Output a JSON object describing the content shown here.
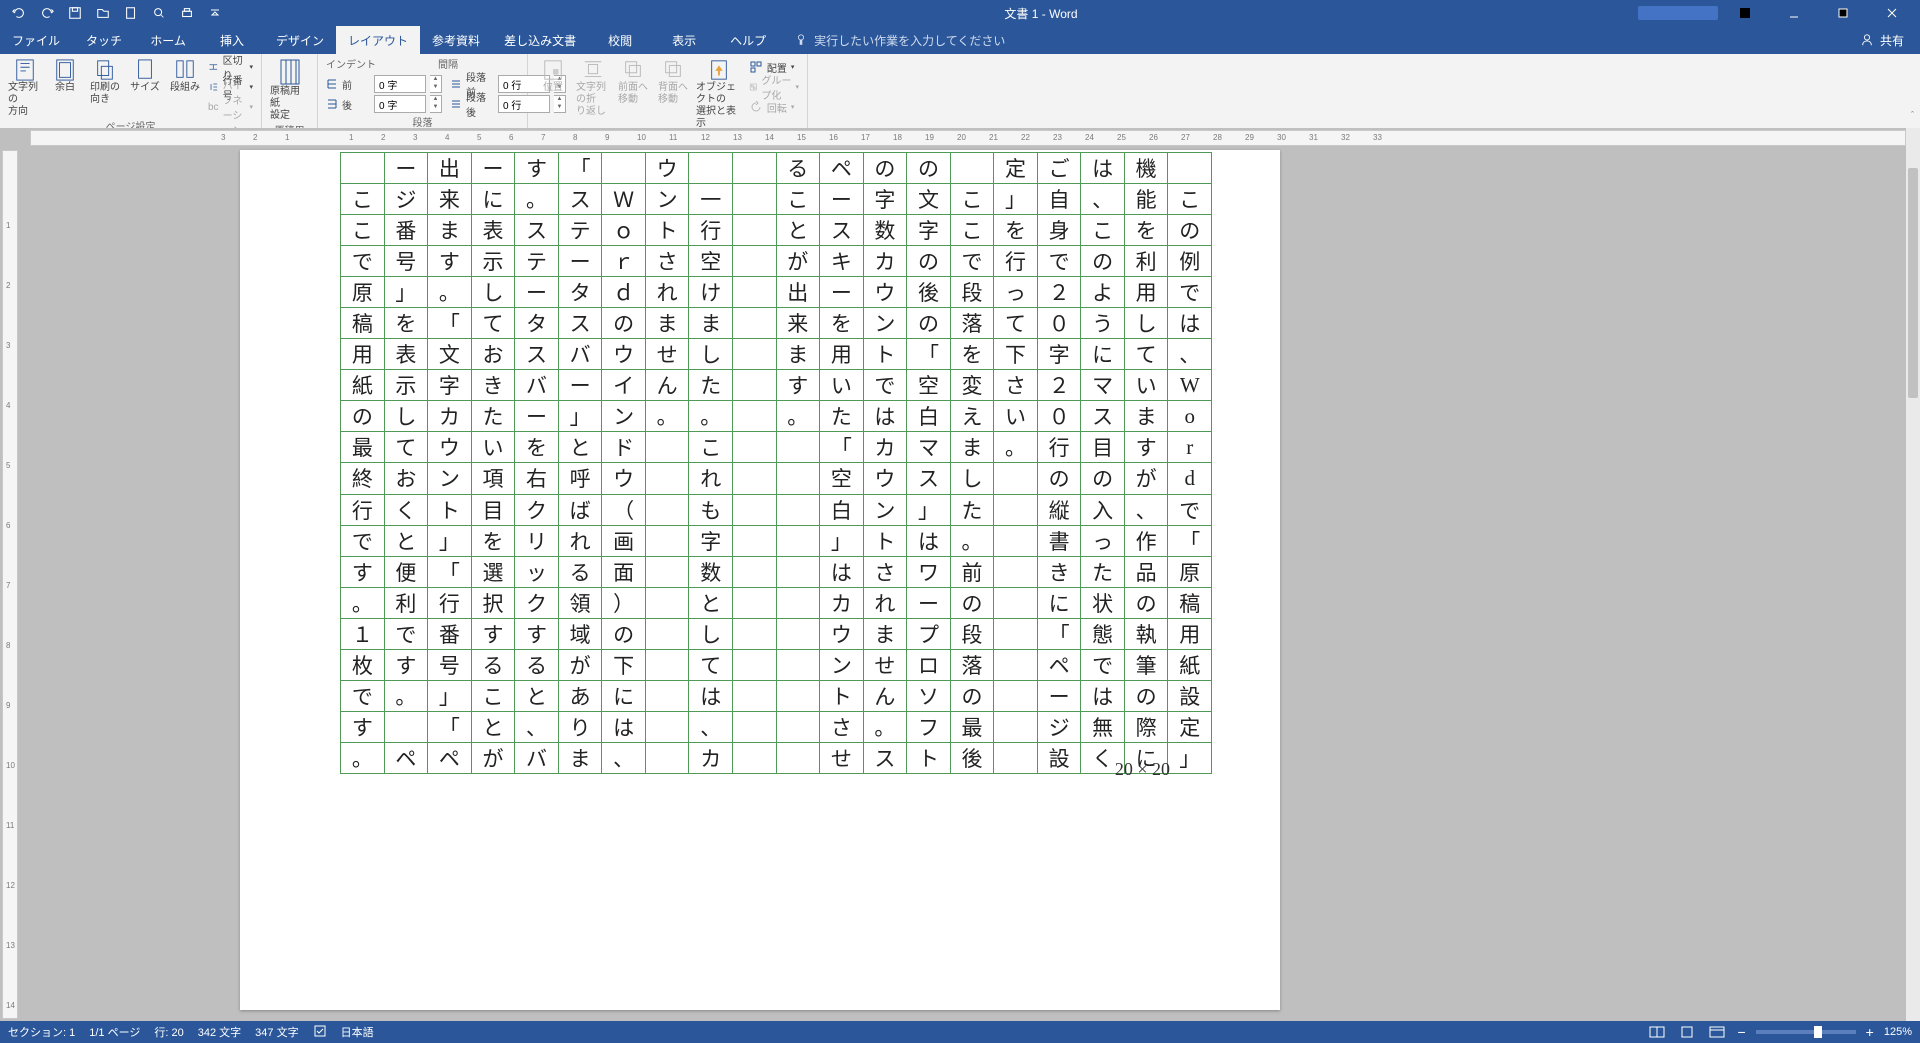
{
  "chrome": {
    "title": "文書 1  -  Word",
    "share": "共有"
  },
  "tabs": {
    "items": [
      "ファイル",
      "タッチ",
      "ホーム",
      "挿入",
      "デザイン",
      "レイアウト",
      "参考資料",
      "差し込み文書",
      "校閲",
      "表示",
      "ヘルプ"
    ],
    "active_index": 5,
    "tell_me": "実行したい作業を入力してください"
  },
  "ribbon": {
    "page_setup": {
      "direction": "文字列の\n方向",
      "margins": "余白",
      "orientation": "印刷の\n向き",
      "size": "サイズ",
      "columns": "段組み",
      "breaks": "区切り",
      "line_numbers": "行番号",
      "hyphenation": "ハイフネーション",
      "group": "ページ設定"
    },
    "genkou": {
      "button": "原稿用紙\n設定",
      "group": "原稿用紙"
    },
    "paragraph": {
      "indent_heading": "インデント",
      "indent_left_label": "前",
      "indent_left_value": "0 字",
      "indent_right_label": "後",
      "indent_right_value": "0 字",
      "spacing_heading": "間隔",
      "spacing_before_label": "段落前",
      "spacing_before_value": "0 行",
      "spacing_after_label": "段落後",
      "spacing_after_value": "0 行",
      "group": "段落"
    },
    "arrange": {
      "position": "位置",
      "wrap": "文字列の折\nり返し",
      "bring_forward": "前面へ\n移動",
      "send_backward": "背面へ\n移動",
      "selection_pane": "オブジェクトの\n選択と表示",
      "align": "配置",
      "group_btn": "グループ化",
      "rotate": "回転",
      "group": "配置"
    }
  },
  "ruler_h": [
    "3",
    "2",
    "1",
    "",
    "1",
    "2",
    "3",
    "4",
    "5",
    "6",
    "7",
    "8",
    "9",
    "10",
    "11",
    "12",
    "13",
    "14",
    "15",
    "16",
    "17",
    "18",
    "19",
    "20",
    "21",
    "22",
    "23",
    "24",
    "25",
    "26",
    "27",
    "28",
    "29",
    "30",
    "31",
    "32",
    "33"
  ],
  "ruler_v": [
    "",
    "1",
    "2",
    "3",
    "4",
    "5",
    "6",
    "7",
    "8",
    "9",
    "10",
    "11",
    "12",
    "13",
    "14"
  ],
  "document": {
    "footer": "20 × 20",
    "columns": [
      [
        "",
        "こ",
        "の",
        "例",
        "で",
        "は",
        "、",
        "W",
        "o",
        "r",
        "d",
        "で",
        "「",
        "原",
        "稿",
        "用",
        "紙",
        "設",
        "定",
        "」"
      ],
      [
        "機",
        "能",
        "を",
        "利",
        "用",
        "し",
        "て",
        "い",
        "ま",
        "す",
        "が",
        "、",
        "作",
        "品",
        "の",
        "執",
        "筆",
        "の",
        "際",
        "に"
      ],
      [
        "は",
        "、",
        "こ",
        "の",
        "よ",
        "う",
        "に",
        "マ",
        "ス",
        "目",
        "の",
        "入",
        "っ",
        "た",
        "状",
        "態",
        "で",
        "は",
        "無",
        "く"
      ],
      [
        "ご",
        "自",
        "身",
        "で",
        "２",
        "０",
        "字",
        "２",
        "０",
        "行",
        "の",
        "縦",
        "書",
        "き",
        "に",
        "「",
        "ペ",
        "ー",
        "ジ",
        "設"
      ],
      [
        "定",
        "」",
        "を",
        "行",
        "っ",
        "て",
        "下",
        "さ",
        "い",
        "。",
        "",
        "",
        "",
        "",
        "",
        "",
        "",
        "",
        "",
        ""
      ],
      [
        "",
        "こ",
        "こ",
        "で",
        "段",
        "落",
        "を",
        "変",
        "え",
        "ま",
        "し",
        "た",
        "。",
        "前",
        "の",
        "段",
        "落",
        "の",
        "最",
        "後"
      ],
      [
        "の",
        "文",
        "字",
        "の",
        "後",
        "の",
        "「",
        "空",
        "白",
        "マ",
        "ス",
        "」",
        "は",
        "ワ",
        "ー",
        "プ",
        "ロ",
        "ソ",
        "フ",
        "ト"
      ],
      [
        "の",
        "字",
        "数",
        "カ",
        "ウ",
        "ン",
        "ト",
        "で",
        "は",
        "カ",
        "ウ",
        "ン",
        "ト",
        "さ",
        "れ",
        "ま",
        "せ",
        "ん",
        "。",
        "ス"
      ],
      [
        "ペ",
        "ー",
        "ス",
        "キ",
        "ー",
        "を",
        "用",
        "い",
        "た",
        "「",
        "空",
        "白",
        "」",
        "は",
        "カ",
        "ウ",
        "ン",
        "ト",
        "さ",
        "せ"
      ],
      [
        "る",
        "こ",
        "と",
        "が",
        "出",
        "来",
        "ま",
        "す",
        "。",
        "",
        "",
        "",
        "",
        "",
        "",
        "",
        "",
        "",
        "",
        ""
      ],
      [
        "",
        "",
        "",
        "",
        "",
        "",
        "",
        "",
        "",
        "",
        "",
        "",
        "",
        "",
        "",
        "",
        "",
        "",
        "",
        ""
      ],
      [
        "",
        "一",
        "行",
        "空",
        "け",
        "ま",
        "し",
        "た",
        "。",
        "こ",
        "れ",
        "も",
        "字",
        "数",
        "と",
        "し",
        "て",
        "は",
        "、",
        "カ"
      ],
      [
        "ウ",
        "ン",
        "ト",
        "さ",
        "れ",
        "ま",
        "せ",
        "ん",
        "。",
        "",
        "",
        "",
        "",
        "",
        "",
        "",
        "",
        "",
        "",
        ""
      ],
      [
        "",
        "Ｗ",
        "ｏ",
        "ｒ",
        "ｄ",
        "の",
        "ウ",
        "イ",
        "ン",
        "ド",
        "ウ",
        "（",
        "画",
        "面",
        "）",
        "の",
        "下",
        "に",
        "は",
        "、"
      ],
      [
        "「",
        "ス",
        "テ",
        "ー",
        "タ",
        "ス",
        "バ",
        "ー",
        "」",
        "と",
        "呼",
        "ば",
        "れ",
        "る",
        "領",
        "域",
        "が",
        "あ",
        "り",
        "ま"
      ],
      [
        "す",
        "。",
        "ス",
        "テ",
        "ー",
        "タ",
        "ス",
        "バ",
        "ー",
        "を",
        "右",
        "ク",
        "リ",
        "ッ",
        "ク",
        "す",
        "る",
        "と",
        "、",
        "バ"
      ],
      [
        "ー",
        "に",
        "表",
        "示",
        "し",
        "て",
        "お",
        "き",
        "た",
        "い",
        "項",
        "目",
        "を",
        "選",
        "択",
        "す",
        "る",
        "こ",
        "と",
        "が"
      ],
      [
        "出",
        "来",
        "ま",
        "す",
        "。",
        "「",
        "文",
        "字",
        "カ",
        "ウ",
        "ン",
        "ト",
        "」",
        "「",
        "行",
        "番",
        "号",
        "」",
        "「",
        "ペ"
      ],
      [
        "ー",
        "ジ",
        "番",
        "号",
        "」",
        "を",
        "表",
        "示",
        "し",
        "て",
        "お",
        "く",
        "と",
        "便",
        "利",
        "で",
        "す",
        "。",
        "",
        "ペ"
      ],
      [
        "",
        "こ",
        "こ",
        "で",
        "原",
        "稿",
        "用",
        "紙",
        "の",
        "最",
        "終",
        "行",
        "で",
        "す",
        "。",
        "１",
        "枚",
        "で",
        "す",
        "。"
      ]
    ]
  },
  "status": {
    "section": "セクション:  1",
    "page": "1/1 ページ",
    "line": "行: 20",
    "words": "342 文字",
    "chars": "347 文字",
    "lang": "日本語",
    "zoom": "125%"
  }
}
